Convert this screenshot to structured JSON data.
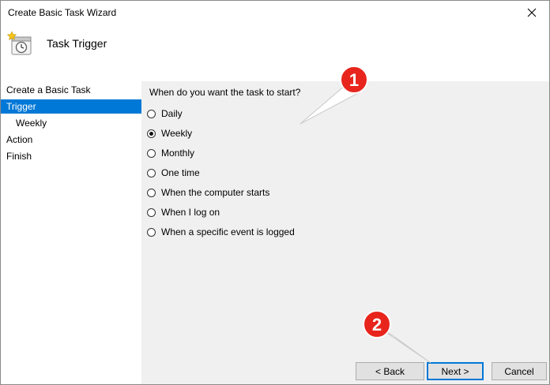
{
  "window": {
    "title": "Create Basic Task Wizard"
  },
  "header": {
    "title": "Task Trigger",
    "icon": "task-scheduler-icon"
  },
  "sidebar": {
    "items": [
      {
        "label": "Create a Basic Task",
        "selected": false
      },
      {
        "label": "Trigger",
        "selected": true
      },
      {
        "label": "Weekly",
        "selected": false
      },
      {
        "label": "Action",
        "selected": false
      },
      {
        "label": "Finish",
        "selected": false
      }
    ]
  },
  "main": {
    "question": "When do you want the task to start?",
    "options": [
      {
        "label": "Daily",
        "checked": false
      },
      {
        "label": "Weekly",
        "checked": true
      },
      {
        "label": "Monthly",
        "checked": false
      },
      {
        "label": "One time",
        "checked": false
      },
      {
        "label": "When the computer starts",
        "checked": false
      },
      {
        "label": "When I log on",
        "checked": false
      },
      {
        "label": "When a specific event is logged",
        "checked": false
      }
    ]
  },
  "buttons": {
    "back": "< Back",
    "next": "Next >",
    "cancel": "Cancel"
  },
  "callouts": [
    "1",
    "2"
  ],
  "colors": {
    "selection": "#0078d7",
    "callout": "#e8251c",
    "panel": "#f0f0f0"
  }
}
